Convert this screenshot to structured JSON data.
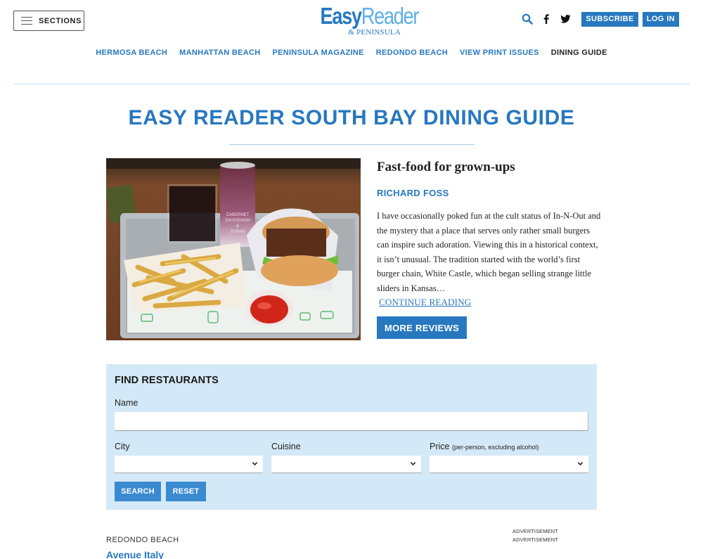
{
  "header": {
    "sections_label": "SECTIONS",
    "logo": {
      "part1": "Easy",
      "part2": "Reader",
      "sub": "& PENINSULA"
    },
    "icons": [
      "search-icon",
      "facebook-icon",
      "twitter-icon"
    ],
    "subscribe_label": "SUBSCRIBE",
    "login_label": "LOG IN"
  },
  "nav": {
    "items": [
      {
        "label": "HERMOSA BEACH",
        "active": false
      },
      {
        "label": "MANHATTAN BEACH",
        "active": false
      },
      {
        "label": "PENINSULA MAGAZINE",
        "active": false
      },
      {
        "label": "REDONDO BEACH",
        "active": false
      },
      {
        "label": "VIEW PRINT ISSUES",
        "active": false
      },
      {
        "label": "DINING GUIDE",
        "active": true
      }
    ]
  },
  "page": {
    "title": "EASY READER SOUTH BAY DINING GUIDE"
  },
  "feature": {
    "image_alt": "Burger, crinkle-cut fries, ketchup and canned Cabernet Sauvignon & Syrah on a tray",
    "title": "Fast-food for grown-ups",
    "author": "RICHARD FOSS",
    "excerpt": "I have occasionally poked fun at the cult status of In-N-Out and the mystery that a place that serves only rather small burgers can inspire such adoration. Viewing this in a historical context, it isn’t unusual. The tradition started with the world’s first burger chain, White Castle, which began selling strange little sliders in Kansas…",
    "continue_label": "CONTINUE READING",
    "more_label": "MORE REVIEWS"
  },
  "finder": {
    "title": "FIND RESTAURANTS",
    "name_label": "Name",
    "name_value": "",
    "city_label": "City",
    "city_value": "",
    "cuisine_label": "Cuisine",
    "cuisine_value": "",
    "price_label": "Price",
    "price_note": "(per-person, excluding alcohol)",
    "price_value": "",
    "search_label": "SEARCH",
    "reset_label": "RESET"
  },
  "listing": {
    "city": "REDONDO BEACH",
    "name": "Avenue Italy"
  },
  "ads": [
    "ADVERTISEMENT",
    "ADVERTISEMENT"
  ],
  "colors": {
    "brand_blue": "#2778bf",
    "logo_light_blue": "#5bb0e6",
    "finder_bg": "#d4e9f7"
  }
}
